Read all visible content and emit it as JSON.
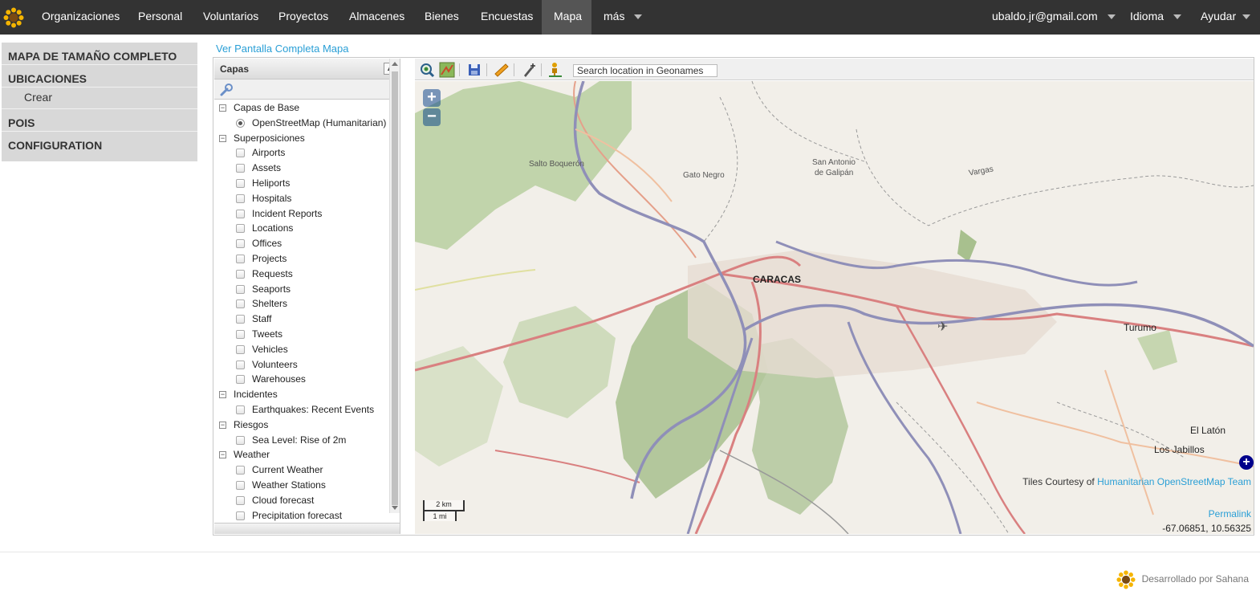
{
  "topnav": {
    "items": [
      {
        "label": "Organizaciones"
      },
      {
        "label": "Personal"
      },
      {
        "label": "Voluntarios"
      },
      {
        "label": "Proyectos"
      },
      {
        "label": "Almacenes"
      },
      {
        "label": "Bienes"
      },
      {
        "label": "Encuestas"
      },
      {
        "label": "Mapa"
      },
      {
        "label": "más"
      }
    ],
    "user": "ubaldo.jr@gmail.com",
    "language": "Idioma",
    "help": "Ayudar"
  },
  "sidemenu": {
    "full_map": "MAPA DE TAMAÑO COMPLETO",
    "locations": "UBICACIONES",
    "create": "Crear",
    "pois": "POIS",
    "configuration": "CONFIGURATION"
  },
  "fullscreen_link": "Ver Pantalla Completa Mapa",
  "layers": {
    "title": "Capas",
    "base_group": "Capas de Base",
    "base_layer": "OpenStreetMap (Humanitarian)",
    "overlays_group": "Superposiciones",
    "overlays": [
      "Airports",
      "Assets",
      "Heliports",
      "Hospitals",
      "Incident Reports",
      "Locations",
      "Offices",
      "Projects",
      "Requests",
      "Seaports",
      "Shelters",
      "Staff",
      "Tweets",
      "Vehicles",
      "Volunteers",
      "Warehouses"
    ],
    "incidents_group": "Incidentes",
    "incidents": [
      "Earthquakes: Recent Events"
    ],
    "risks_group": "Riesgos",
    "risks": [
      "Sea Level: Rise of 2m"
    ],
    "weather_group": "Weather",
    "weather": [
      "Current Weather",
      "Weather Stations",
      "Cloud forecast",
      "Precipitation forecast"
    ]
  },
  "map": {
    "search_placeholder": "Search location in Geonames",
    "labels": {
      "salto": "Salto Boquerón",
      "gato": "Gato Negro",
      "sanantonio1": "San Antonio",
      "sanantonio2": "de Galipán",
      "vargas": "Vargas",
      "caracas": "CARACAS",
      "turumo": "Turumo",
      "ellaton": "El Latón",
      "losjabillos": "Los Jabillos"
    },
    "attribution_prefix": "Tiles Courtesy of",
    "attribution_link": "Humanitarian OpenStreetMap Team",
    "permalink": "Permalink",
    "coords": "-67.06851, 10.56325",
    "scale_km": "2 km",
    "scale_mi": "1 mi"
  },
  "footer": {
    "text": "Desarrollado por Sahana"
  },
  "colors": {
    "nav_bg": "#333333",
    "nav_active": "#555555",
    "link": "#2a9fd6",
    "side_bg": "#d8d8d8"
  }
}
